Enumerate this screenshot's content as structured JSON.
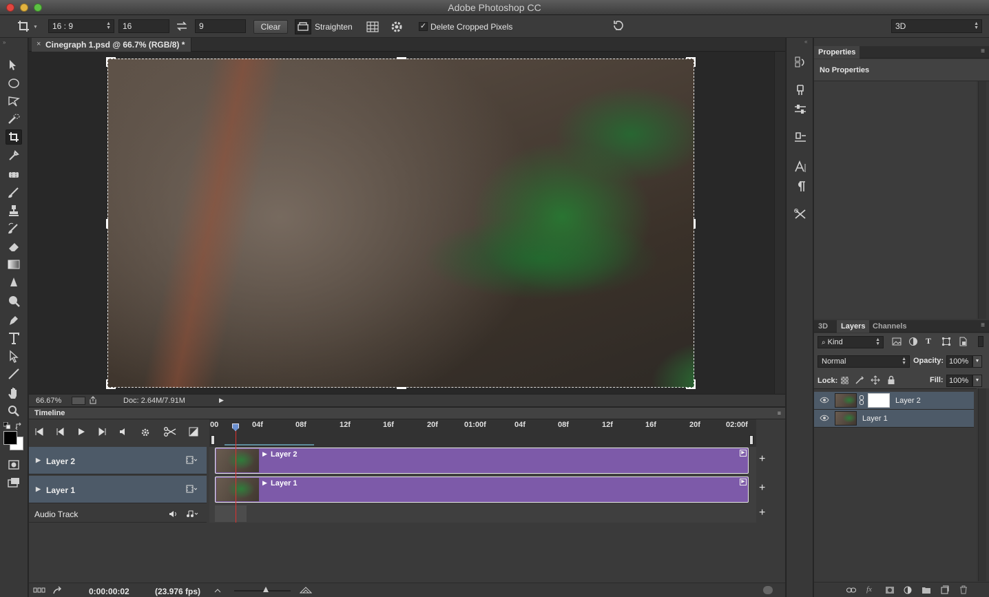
{
  "app": {
    "title": "Adobe Photoshop CC"
  },
  "options": {
    "ratio": "16 : 9",
    "width": "16",
    "height": "9",
    "clear": "Clear",
    "straighten": "Straighten",
    "delete_cropped": "Delete Cropped Pixels",
    "workspace": "3D"
  },
  "document": {
    "tab": "Cinegraph 1.psd @ 66.7% (RGB/8) *"
  },
  "status": {
    "zoom": "66.67%",
    "doc": "Doc: 2.64M/7.91M"
  },
  "timeline": {
    "title": "Timeline",
    "ruler": [
      "00",
      "04f",
      "08f",
      "12f",
      "16f",
      "20f",
      "01:00f",
      "04f",
      "08f",
      "12f",
      "16f",
      "20f",
      "02:00f"
    ],
    "tracks": [
      {
        "label": "Layer 2",
        "clip": "Layer 2"
      },
      {
        "label": "Layer 1",
        "clip": "Layer 1"
      }
    ],
    "audio": "Audio Track",
    "time": "0:00:00:02",
    "fps": "(23.976 fps)"
  },
  "properties": {
    "tab": "Properties",
    "empty": "No Properties"
  },
  "layers": {
    "tabs": [
      "3D",
      "Layers",
      "Channels"
    ],
    "filter": "Kind",
    "blend": "Normal",
    "opacity_label": "Opacity:",
    "opacity": "100%",
    "lock_label": "Lock:",
    "fill_label": "Fill:",
    "fill": "100%",
    "items": [
      "Layer 2",
      "Layer 1"
    ]
  },
  "colors": {
    "accent_track": "#4d5a68",
    "clip": "#7d5aa9",
    "playhead": "#e0302e"
  },
  "icons": [
    "crop-icon",
    "move-icon",
    "marquee-icon",
    "lasso-icon",
    "eyedropper-icon",
    "brush-icon",
    "eye-icon",
    "link-icon",
    "gear-icon",
    "scissors-icon",
    "play-icon",
    "audio-icon"
  ]
}
